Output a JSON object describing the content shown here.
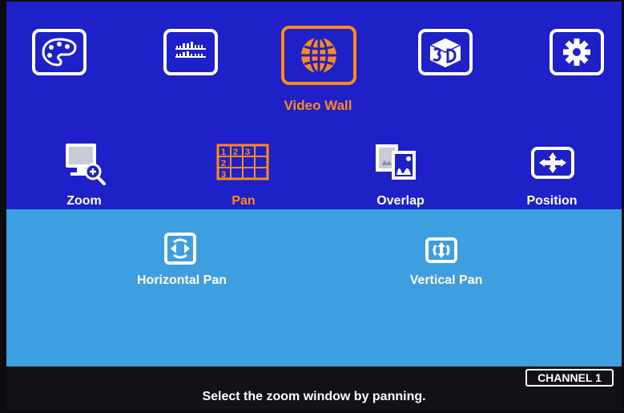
{
  "main_menu": {
    "items": [
      {
        "icon": "palette-icon"
      },
      {
        "icon": "adjust-sliders-icon"
      },
      {
        "icon": "globe-icon",
        "label": "Video Wall",
        "active": true
      },
      {
        "icon": "3d-icon"
      },
      {
        "icon": "settings-gear-icon"
      }
    ]
  },
  "sub_menu": {
    "items": [
      {
        "label": "Zoom",
        "icon": "zoom-monitor-icon"
      },
      {
        "label": "Pan",
        "icon": "pan-grid-icon",
        "active": true,
        "grid_numbers": [
          "1",
          "2",
          "3"
        ]
      },
      {
        "label": "Overlap",
        "icon": "overlap-pictures-icon"
      },
      {
        "label": "Position",
        "icon": "position-arrows-icon"
      }
    ]
  },
  "pan_options": {
    "items": [
      {
        "label": "Horizontal Pan",
        "icon": "horizontal-pan-icon"
      },
      {
        "label": "Vertical Pan",
        "icon": "vertical-pan-icon"
      }
    ]
  },
  "status": {
    "message": "Select the zoom window by panning.",
    "channel": "CHANNEL 1"
  },
  "colors": {
    "top_panel": "#1f21c8",
    "bottom_panel": "#3d9ee0",
    "highlight": "#ff8a1c",
    "text": "#ffffff"
  }
}
